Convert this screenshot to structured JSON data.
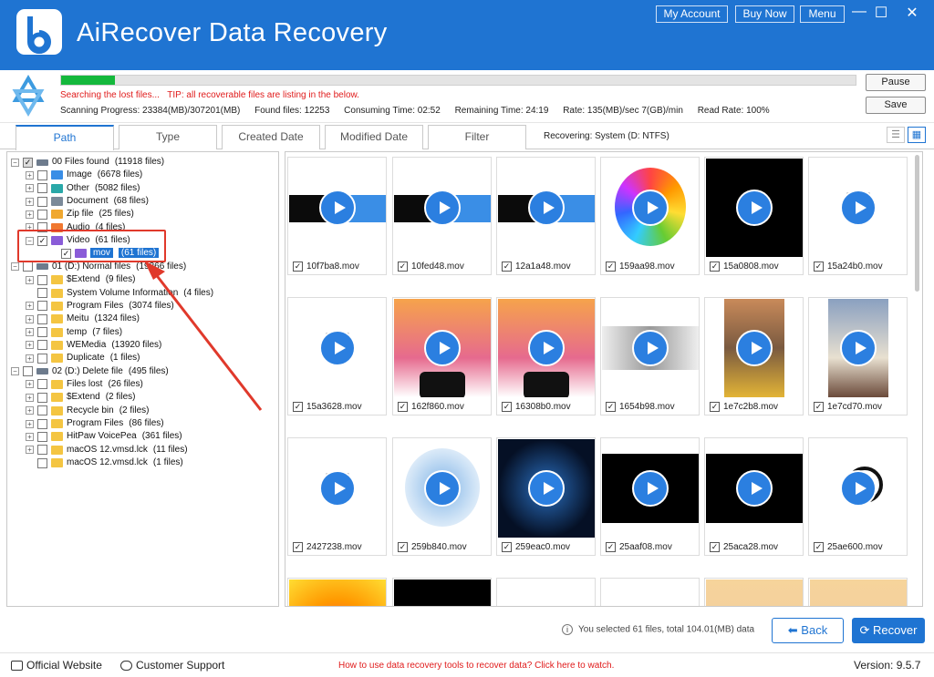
{
  "app": {
    "title": "AiRecover Data Recovery"
  },
  "header": {
    "my_account": "My Account",
    "buy_now": "Buy Now",
    "menu": "Menu",
    "minimize": "—",
    "maximize": "☐",
    "close": "✕"
  },
  "scan": {
    "progress_fraction": 0.068,
    "status": "Searching the lost files...",
    "tip": "TIP: all recoverable files are listing in the below.",
    "scanning_progress": "Scanning Progress: 23384(MB)/307201(MB)",
    "found_files": "Found files: 12253",
    "consuming_time": "Consuming Time: 02:52",
    "remaining_time": "Remaining Time: 24:19",
    "rate": "Rate: 135(MB)/sec  7(GB)/min",
    "read_rate": "Read Rate: 100%",
    "pause_label": "Pause",
    "save_label": "Save"
  },
  "tabs": [
    {
      "label": "Path"
    },
    {
      "label": "Type"
    },
    {
      "label": "Created Date"
    },
    {
      "label": "Modified Date"
    },
    {
      "label": "Filter"
    }
  ],
  "recovering": "Recovering: System (D: NTFS)",
  "tree": [
    {
      "label": "00 Files found",
      "count": "(11918 files)"
    },
    {
      "label": "Image",
      "count": "(6678 files)"
    },
    {
      "label": "Other",
      "count": "(5082 files)"
    },
    {
      "label": "Document",
      "count": "(68 files)"
    },
    {
      "label": "Zip file",
      "count": "(25 files)"
    },
    {
      "label": "Audio",
      "count": "(4 files)"
    },
    {
      "label": "Video",
      "count": "(61 files)"
    },
    {
      "label": "mov",
      "count": "(61 files)"
    },
    {
      "label": "01 (D:) Normal files",
      "count": "(19366 files)"
    },
    {
      "label": "$Extend",
      "count": "(9 files)"
    },
    {
      "label": "System Volume Information",
      "count": "(4 files)"
    },
    {
      "label": "Program Files",
      "count": "(3074 files)"
    },
    {
      "label": "Meitu",
      "count": "(1324 files)"
    },
    {
      "label": "temp",
      "count": "(7 files)"
    },
    {
      "label": "WEMedia",
      "count": "(13920 files)"
    },
    {
      "label": "Duplicate",
      "count": "(1 files)"
    },
    {
      "label": "02 (D:) Delete file",
      "count": "(495 files)"
    },
    {
      "label": "Files lost",
      "count": "(26 files)"
    },
    {
      "label": "$Extend",
      "count": "(2 files)"
    },
    {
      "label": "Recycle bin",
      "count": "(2 files)"
    },
    {
      "label": "Program Files",
      "count": "(86 files)"
    },
    {
      "label": "HitPaw VoicePea",
      "count": "(361 files)"
    },
    {
      "label": "macOS 12.vmsd.lck",
      "count": "(11 files)"
    },
    {
      "label": "macOS 12.vmsd.lck",
      "count": "(1 files)"
    }
  ],
  "files": [
    {
      "name": "10f7ba8.mov"
    },
    {
      "name": "10fed48.mov"
    },
    {
      "name": "12a1a48.mov"
    },
    {
      "name": "159aa98.mov"
    },
    {
      "name": "15a0808.mov"
    },
    {
      "name": "15a24b0.mov"
    },
    {
      "name": "15a3628.mov"
    },
    {
      "name": "162f860.mov"
    },
    {
      "name": "16308b0.mov"
    },
    {
      "name": "1654b98.mov"
    },
    {
      "name": "1e7c2b8.mov"
    },
    {
      "name": "1e7cd70.mov"
    },
    {
      "name": "2427238.mov"
    },
    {
      "name": "259b840.mov"
    },
    {
      "name": "259eac0.mov"
    },
    {
      "name": "25aaf08.mov"
    },
    {
      "name": "25aca28.mov"
    },
    {
      "name": "25ae600.mov"
    }
  ],
  "check_mark": "✓",
  "selection_info": "You selected 61 files, total 104.01(MB) data",
  "back_label": "Back",
  "recover_label": "Recover",
  "footer": {
    "official_website": "Official Website",
    "customer_support": "Customer Support",
    "howto": "How to use data recovery tools to recover data? Click here to watch.",
    "version": "Version: 9.5.7"
  },
  "colors": {
    "brand": "#1f74d2",
    "progress": "#14b83c",
    "tip": "#e01b1b",
    "highlight": "#e0392b"
  }
}
